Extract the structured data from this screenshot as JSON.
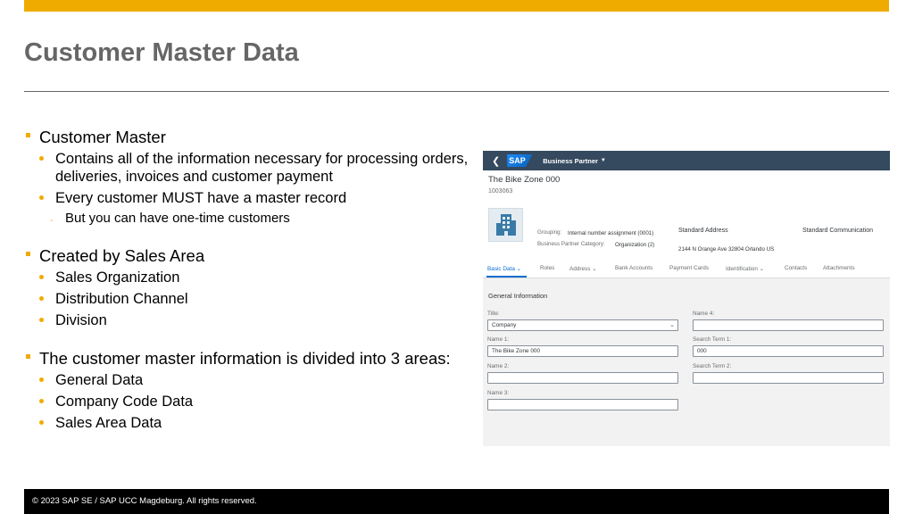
{
  "slide": {
    "title": "Customer Master Data",
    "accent_color": "#f0ab00",
    "footer": "© 2023 SAP SE / SAP UCC Magdeburg. All rights reserved."
  },
  "bullets": {
    "g1": {
      "l1": "Customer Master",
      "a": "Contains all of the information necessary for processing orders, deliveries, invoices and customer payment",
      "b": "Every customer MUST have a master record",
      "b_sub": "But you can have one-time customers"
    },
    "g2": {
      "l1": "Created by Sales Area",
      "a": "Sales Organization",
      "b": "Distribution Channel",
      "c": "Division"
    },
    "g3": {
      "l1": "The customer master information is divided into 3 areas:",
      "a": "General Data",
      "b": "Company Code Data",
      "c": "Sales Area Data"
    }
  },
  "sap": {
    "logo": "SAP",
    "app_title": "Business Partner",
    "back_icon": "chevron-left-icon",
    "bp_name": "The Bike Zone 000",
    "bp_id": "1003063",
    "bp_icon": "building-icon",
    "grouping_label": "Grouping:",
    "grouping_value": "Internal number assignment (0001)",
    "category_label": "Business Partner Category:",
    "category_value": "Organization (2)",
    "std_address_label": "Standard Address",
    "std_address_value": "2144 N Orange Ave 32804 Orlando US",
    "std_comm_label": "Standard Communication",
    "tabs": [
      "Basic Data",
      "Roles",
      "Address",
      "Bank Accounts",
      "Payment Cards",
      "Identification",
      "Contacts",
      "Attachments"
    ],
    "section_title": "General Information",
    "fields": {
      "title_label": "Title:",
      "title_value": "Company",
      "name1_label": "Name 1:",
      "name1_value": "The Bike Zone 000",
      "name2_label": "Name 2:",
      "name2_value": "",
      "name3_label": "Name 3:",
      "name3_value": "",
      "name4_label": "Name 4:",
      "name4_value": "",
      "search1_label": "Search Term 1:",
      "search1_value": "000",
      "search2_label": "Search Term 2:",
      "search2_value": ""
    }
  }
}
